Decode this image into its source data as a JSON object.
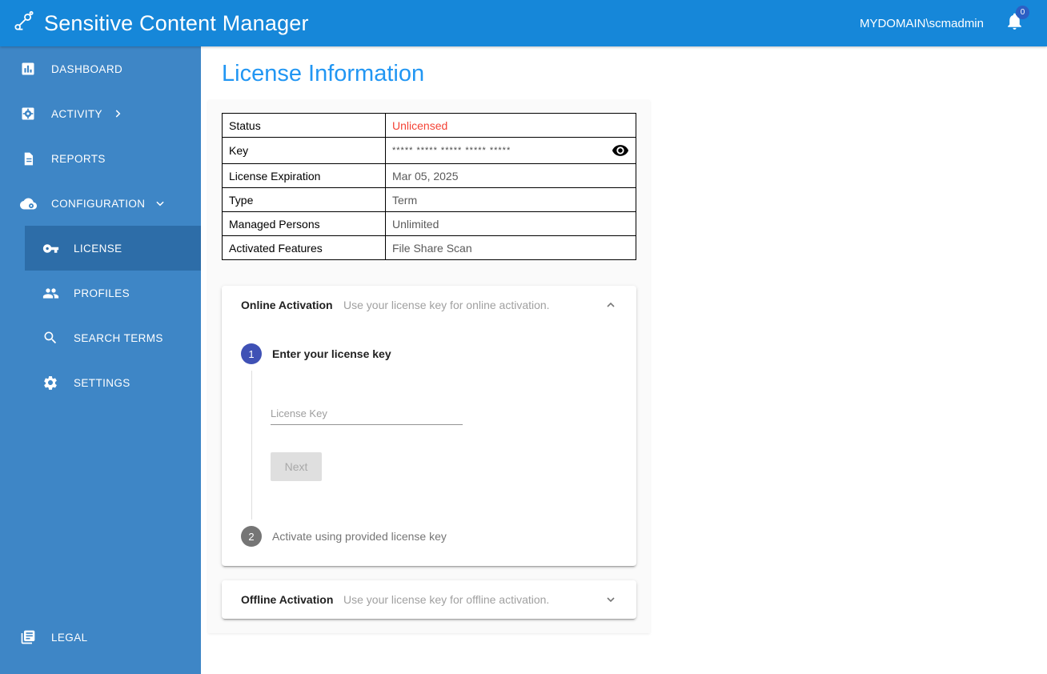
{
  "header": {
    "title": "Sensitive Content Manager",
    "user": "MYDOMAIN\\scmadmin",
    "notification_count": "0"
  },
  "sidebar": {
    "items": [
      {
        "label": "DASHBOARD"
      },
      {
        "label": "ACTIVITY"
      },
      {
        "label": "REPORTS"
      },
      {
        "label": "CONFIGURATION"
      },
      {
        "label": "LICENSE"
      },
      {
        "label": "PROFILES"
      },
      {
        "label": "SEARCH TERMS"
      },
      {
        "label": "SETTINGS"
      },
      {
        "label": "LEGAL"
      }
    ]
  },
  "main": {
    "page_title": "License Information",
    "license_table": {
      "rows": [
        {
          "label": "Status",
          "value": "Unlicensed"
        },
        {
          "label": "Key",
          "value": "***** ***** ***** ***** *****"
        },
        {
          "label": "License Expiration",
          "value": "Mar 05, 2025"
        },
        {
          "label": "Type",
          "value": "Term"
        },
        {
          "label": "Managed Persons",
          "value": "Unlimited"
        },
        {
          "label": "Activated Features",
          "value": "File Share Scan"
        }
      ]
    },
    "online_activation": {
      "title": "Online Activation",
      "description": "Use your license key for online activation.",
      "step1": {
        "number": "1",
        "label": "Enter your license key",
        "input_placeholder": "License Key",
        "next_label": "Next"
      },
      "step2": {
        "number": "2",
        "label": "Activate using provided license key"
      }
    },
    "offline_activation": {
      "title": "Offline Activation",
      "description": "Use your license key for offline activation."
    }
  },
  "colors": {
    "header_blue": "#1687d9",
    "sidebar_blue": "#3e86c6",
    "selected_blue": "#2d6da8",
    "title_blue": "#2196f3",
    "error_red": "#f44336",
    "step_active_blue": "#3f51b5"
  }
}
